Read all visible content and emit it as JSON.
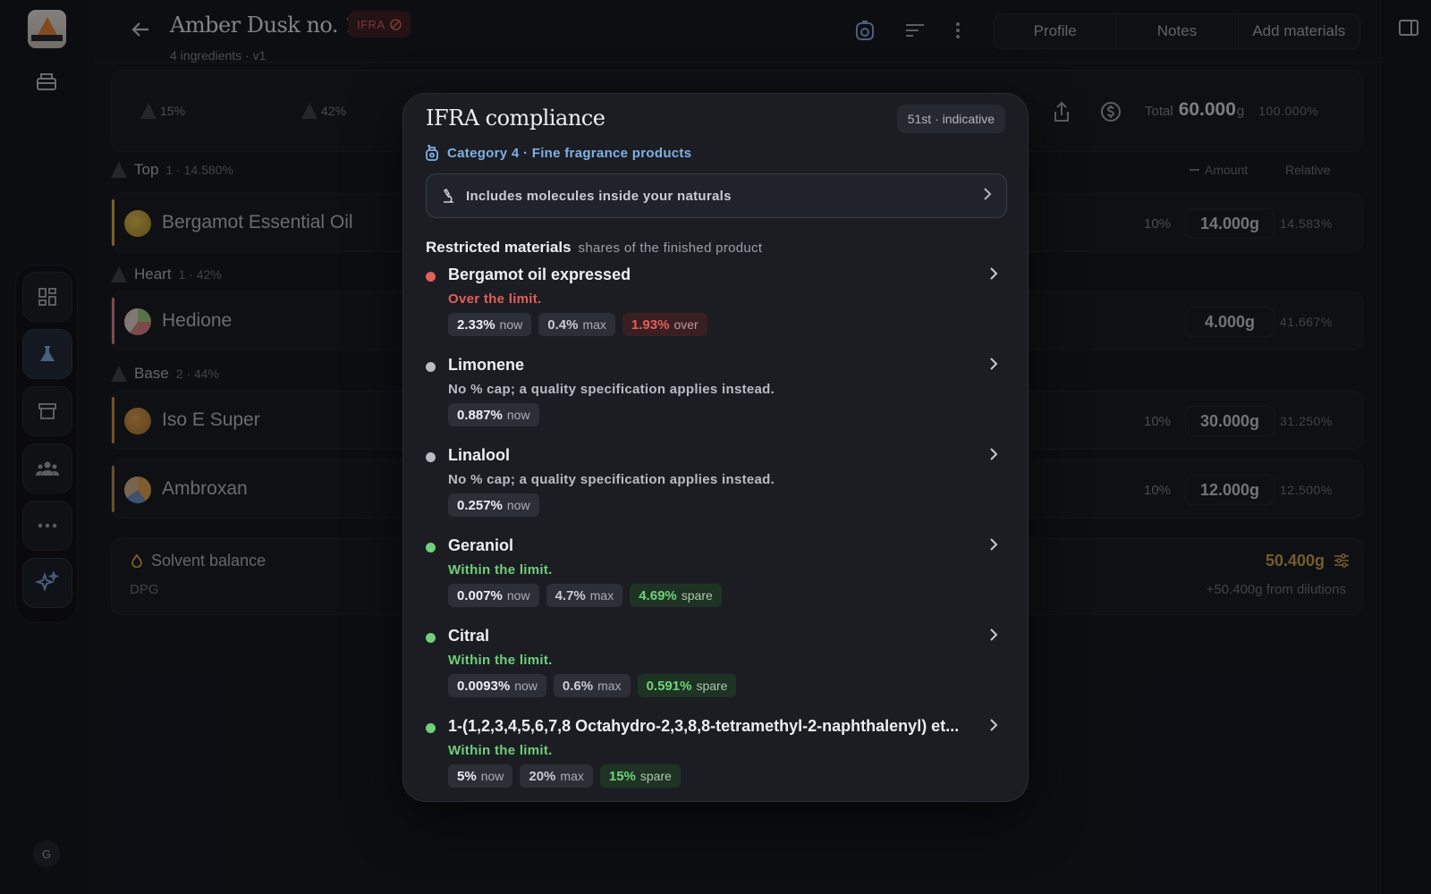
{
  "header": {
    "title": "Amber Dusk no. 1",
    "ifra_badge": "IFRA",
    "subtitle": "4 ingredients · v1",
    "tabs": [
      "Profile",
      "Notes",
      "Add materials"
    ]
  },
  "summary": {
    "pyramid_top": "15%",
    "pyramid_heart": "42%",
    "total_label": "Total",
    "total_amount": "60.000",
    "total_unit": "g",
    "total_percent": "100.000%"
  },
  "columns": {
    "amount": "Amount",
    "relative": "Relative"
  },
  "sections": [
    {
      "name": "Top",
      "meta": "1 · 14.580%"
    },
    {
      "name": "Heart",
      "meta": "1 · 42%"
    },
    {
      "name": "Base",
      "meta": "2 · 44%"
    }
  ],
  "ingredients": [
    {
      "name": "Bergamot Essential Oil",
      "dilution": "10%",
      "amount": "14.000g",
      "relative": "14.583%",
      "accent": "#d6a93b"
    },
    {
      "name": "Hedione",
      "dilution": "",
      "amount": "4.000g",
      "relative": "41.667%",
      "accent": "#d98080"
    },
    {
      "name": "Iso E Super",
      "dilution": "10%",
      "amount": "30.000g",
      "relative": "31.250%",
      "accent": "#c98b3a"
    },
    {
      "name": "Ambroxan",
      "dilution": "10%",
      "amount": "12.000g",
      "relative": "12.500%",
      "accent": "#b98450"
    }
  ],
  "solvent": {
    "title": "Solvent balance",
    "name": "DPG",
    "amount": "50.400g",
    "note": "+50.400g from dilutions"
  },
  "rail": {
    "avatar_initial": "G"
  },
  "modal": {
    "title": "IFRA compliance",
    "badge": "51st · indicative",
    "category": "Category 4 · Fine fragrance products",
    "molecules_box": "Includes molecules inside your naturals",
    "restricted_heading": "Restricted materials",
    "restricted_sub": "shares of the finished product",
    "items": [
      {
        "name": "Bergamot oil expressed",
        "status": "Over the limit.",
        "status_type": "red",
        "now": "2.33%",
        "max": "0.4%",
        "extra": "1.93%",
        "extra_label": "over"
      },
      {
        "name": "Limonene",
        "status": "No % cap; a quality specification applies instead.",
        "status_type": "grey",
        "now": "0.887%"
      },
      {
        "name": "Linalool",
        "status": "No % cap; a quality specification applies instead.",
        "status_type": "grey",
        "now": "0.257%"
      },
      {
        "name": "Geraniol",
        "status": "Within the limit.",
        "status_type": "green",
        "now": "0.007%",
        "max": "4.7%",
        "extra": "4.69%",
        "extra_label": "spare"
      },
      {
        "name": "Citral",
        "status": "Within the limit.",
        "status_type": "green",
        "now": "0.0093%",
        "max": "0.6%",
        "extra": "0.591%",
        "extra_label": "spare"
      },
      {
        "name": "1-(1,2,3,4,5,6,7,8 Octahydro-2,3,8,8-tetramethyl-2-naphthalenyl) et...",
        "status": "Within the limit.",
        "status_type": "green",
        "now": "5%",
        "max": "20%",
        "extra": "15%",
        "extra_label": "spare"
      }
    ],
    "labels": {
      "now": "now",
      "max": "max"
    }
  },
  "colors": {
    "over": "#e0605b",
    "within": "#6fcf7a",
    "neutral": "#b7bbc3",
    "solvent_accent": "#d6a93b"
  }
}
